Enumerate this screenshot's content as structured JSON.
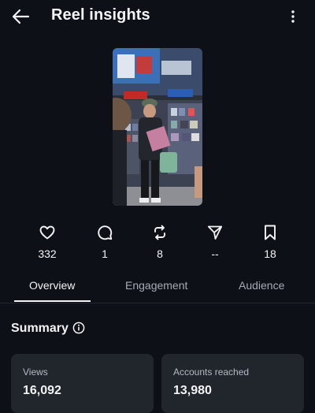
{
  "header": {
    "title": "Reel insights",
    "back_icon": "arrow-left-icon",
    "more_icon": "more-vertical-icon"
  },
  "reel": {
    "thumbnail": "reel-video-thumbnail"
  },
  "stats": [
    {
      "name": "likes",
      "icon": "heart-icon",
      "value": "332"
    },
    {
      "name": "comments",
      "icon": "comment-icon",
      "value": "1"
    },
    {
      "name": "reposts",
      "icon": "repost-icon",
      "value": "8"
    },
    {
      "name": "shares",
      "icon": "send-icon",
      "value": "--"
    },
    {
      "name": "saves",
      "icon": "bookmark-icon",
      "value": "18"
    }
  ],
  "tabs": [
    {
      "label": "Overview",
      "active": true
    },
    {
      "label": "Engagement",
      "active": false
    },
    {
      "label": "Audience",
      "active": false
    }
  ],
  "summary": {
    "title": "Summary",
    "cards": [
      {
        "label": "Views",
        "value": "16,092"
      },
      {
        "label": "Accounts reached",
        "value": "13,980"
      }
    ]
  },
  "colors": {
    "background": "#0d1117",
    "card": "#21252c",
    "text": "#f2f3f5",
    "muted": "#a6abb3"
  }
}
